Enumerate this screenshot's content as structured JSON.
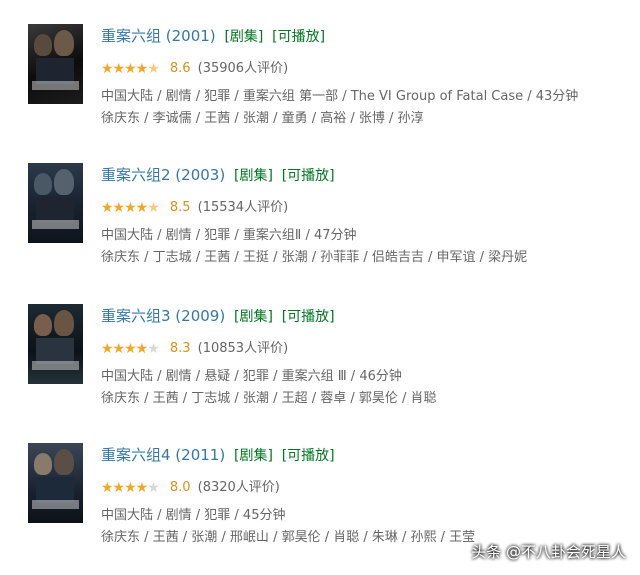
{
  "tags": {
    "series": "[剧集]",
    "playable": "[可播放]"
  },
  "items": [
    {
      "title": "重案六组 (2001)",
      "stars": "★★★★★",
      "score": "8.6",
      "votes": "(35906人评价)",
      "info": "中国大陆 / 剧情 / 犯罪 / 重案六组 第一部 / The VI Group of Fatal Case / 43分钟",
      "cast": "徐庆东 / 李诚儒 / 王茜 / 张潮 / 童勇 / 高裕 / 张博 / 孙淳"
    },
    {
      "title": "重案六组2 (2003)",
      "stars": "★★★★★",
      "score": "8.5",
      "votes": "(15534人评价)",
      "info": "中国大陆 / 剧情 / 犯罪 / 重案六组Ⅱ / 47分钟",
      "cast": "徐庆东 / 丁志城 / 王茜 / 王挺 / 张潮 / 孙菲菲 / 侣皓吉吉 / 申军谊 / 梁丹妮"
    },
    {
      "title": "重案六组3 (2009)",
      "stars": "★★★★",
      "score": "8.3",
      "votes": "(10853人评价)",
      "info": "中国大陆 / 剧情 / 悬疑 / 犯罪 / 重案六组 Ⅲ / 46分钟",
      "cast": "徐庆东 / 王茜 / 丁志城 / 张潮 / 王超 / 蓉卓 / 郭昊伦 / 肖聪"
    },
    {
      "title": "重案六组4 (2011)",
      "stars": "★★★★",
      "score": "8.0",
      "votes": "(8320人评价)",
      "info": "中国大陆 / 剧情 / 犯罪 / 45分钟",
      "cast": "徐庆东 / 王茜 / 张潮 / 邢岷山 / 郭昊伦 / 肖聪 / 朱琳 / 孙熙 / 王莹"
    }
  ],
  "watermark": "头条 @不八卦会死星人"
}
